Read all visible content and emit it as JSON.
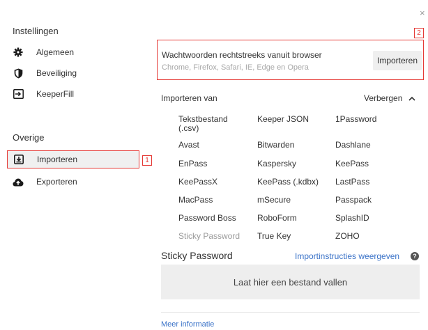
{
  "window": {
    "close_label": "×"
  },
  "sidebar": {
    "settings_title": "Instellingen",
    "settings_items": [
      {
        "label": "Algemeen",
        "icon": "gear-icon"
      },
      {
        "label": "Beveiliging",
        "icon": "shield-icon"
      },
      {
        "label": "KeeperFill",
        "icon": "keeperfill-icon"
      }
    ],
    "other_title": "Overige",
    "other_items": [
      {
        "label": "Importeren",
        "icon": "import-icon",
        "active": true
      },
      {
        "label": "Exporteren",
        "icon": "cloud-upload-icon"
      }
    ]
  },
  "callouts": {
    "one": "1",
    "two": "2"
  },
  "main": {
    "browser_title": "Wachtwoorden rechtstreeks vanuit browser",
    "browser_subtitle": "Chrome, Firefox, Safari, IE, Edge en Opera",
    "import_button": "Importeren",
    "import_from_label": "Importeren van",
    "hide_label": "Verbergen",
    "sources": [
      [
        "Tekstbestand (.csv)",
        "Keeper JSON",
        "1Password"
      ],
      [
        "Avast",
        "Bitwarden",
        "Dashlane"
      ],
      [
        "EnPass",
        "Kaspersky",
        "KeePass"
      ],
      [
        "KeePassX",
        "KeePass (.kdbx)",
        "LastPass"
      ],
      [
        "MacPass",
        "mSecure",
        "Passpack"
      ],
      [
        "Password Boss",
        "RoboForm",
        "SplashID"
      ],
      [
        "Sticky Password",
        "True Key",
        "ZOHO"
      ]
    ],
    "sources_selected": "Sticky Password",
    "selected_title": "Sticky Password",
    "instructions_link": "Importinstructies weergeven",
    "help_icon_label": "?",
    "dropzone_text": "Laat hier een bestand vallen",
    "more_info_link": "Meer informatie"
  },
  "colors": {
    "accent_link": "#3b73c8",
    "callout_red": "#e53935",
    "active_bg": "#f0f0f0"
  }
}
